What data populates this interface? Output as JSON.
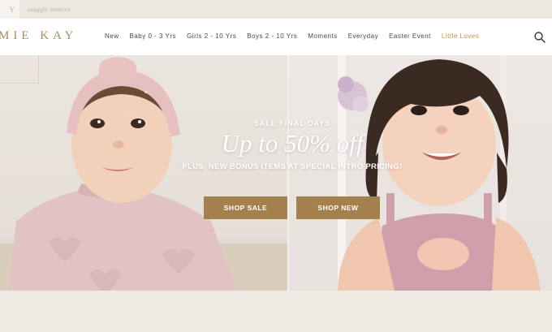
{
  "brand_tabs": [
    {
      "label": "Y"
    },
    {
      "label": "snuggle bunnies"
    }
  ],
  "header": {
    "logo": "MIE KAY",
    "nav": [
      {
        "label": "New"
      },
      {
        "label": "Baby 0 - 3 Yrs"
      },
      {
        "label": "Girls 2 - 10 Yrs"
      },
      {
        "label": "Boys 2 - 10 Yrs"
      },
      {
        "label": "Moments"
      },
      {
        "label": "Everyday"
      },
      {
        "label": "Easter Event"
      },
      {
        "label": "Little Loves"
      }
    ],
    "search_icon": "search-icon"
  },
  "hero": {
    "kicker": "SALE FINAL DAYS",
    "headline": "Up to 50% off",
    "subline": "PLUS, NEW BONUS ITEMS AT SPECIAL INTRO PRICING!",
    "buttons": [
      {
        "label": "SHOP SALE"
      },
      {
        "label": "SHOP NEW"
      }
    ]
  },
  "colors": {
    "accent_gold": "#a88d5e",
    "button_brown": "#a4804c",
    "nav_highlight": "#b59448",
    "background": "#efebe4"
  }
}
